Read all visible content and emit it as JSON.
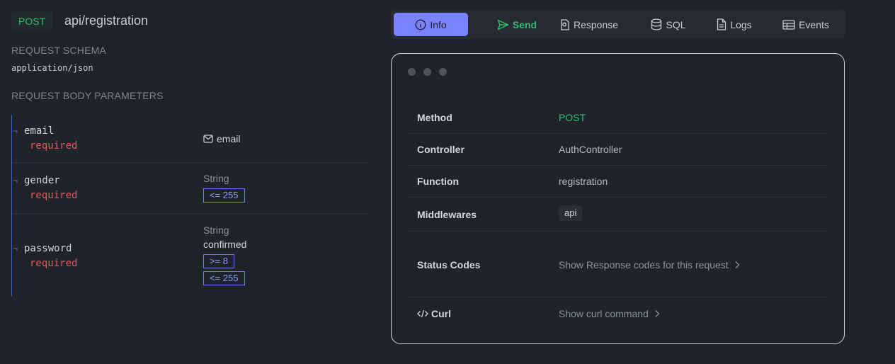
{
  "header": {
    "method": "POST",
    "route": "api/registration"
  },
  "request_schema": {
    "label": "REQUEST SCHEMA",
    "value": "application/json"
  },
  "body_params": {
    "label": "REQUEST BODY PARAMETERS",
    "tick": "¬",
    "items": [
      {
        "name": "email",
        "required": "required",
        "type": "",
        "value": "email",
        "value_icon": "mail-icon",
        "constraints": []
      },
      {
        "name": "gender",
        "required": "required",
        "type": "String",
        "value": "",
        "constraints": [
          "<= 255"
        ]
      },
      {
        "name": "password",
        "required": "required",
        "type": "String",
        "value": "confirmed",
        "constraints": [
          ">= 8",
          "<= 255"
        ]
      }
    ]
  },
  "tabs": [
    {
      "label": "Info",
      "icon": "info-icon",
      "active": true
    },
    {
      "label": "Send",
      "icon": "send-icon",
      "active": false
    },
    {
      "label": "Response",
      "icon": "response-file-icon",
      "active": false
    },
    {
      "label": "SQL",
      "icon": "database-icon",
      "active": false
    },
    {
      "label": "Logs",
      "icon": "document-icon",
      "active": false
    },
    {
      "label": "Events",
      "icon": "table-icon",
      "active": false
    }
  ],
  "info": {
    "method": {
      "key": "Method",
      "value": "POST"
    },
    "controller": {
      "key": "Controller",
      "value": "AuthController"
    },
    "function": {
      "key": "Function",
      "value": "registration"
    },
    "middlewares": {
      "key": "Middlewares",
      "values": [
        "api"
      ]
    },
    "status_codes": {
      "key": "Status Codes",
      "link": "Show Response codes for this request"
    },
    "curl": {
      "key": "Curl",
      "link": "Show curl command"
    }
  },
  "colors": {
    "accent": "#7b82ff",
    "method_green": "#2fbf71",
    "required_red": "#f0525c",
    "constraint_blue": "#8f9bff",
    "background": "#1f232a"
  }
}
